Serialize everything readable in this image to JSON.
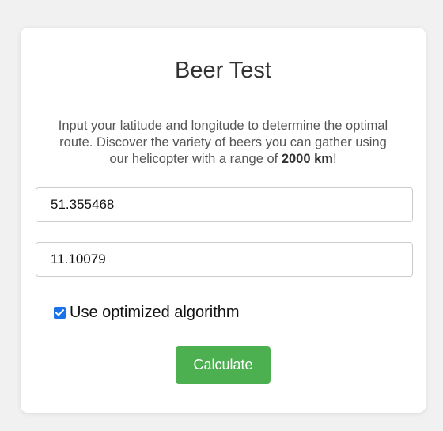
{
  "title": "Beer Test",
  "description": {
    "before": "Input your latitude and longitude to determine the optimal route. Discover the variety of beers you can gather using our helicopter with a range of ",
    "highlight": "2000 km",
    "after": "!"
  },
  "inputs": {
    "latitude_value": "51.355468",
    "longitude_value": "11.10079"
  },
  "options": {
    "optimized_label": "Use optimized algorithm",
    "optimized_checked": true
  },
  "actions": {
    "calculate_label": "Calculate"
  },
  "colors": {
    "button": "#4caf50",
    "checkbox": "#1a73e8"
  },
  "icons": {
    "checkbox": "checkmark-icon"
  }
}
